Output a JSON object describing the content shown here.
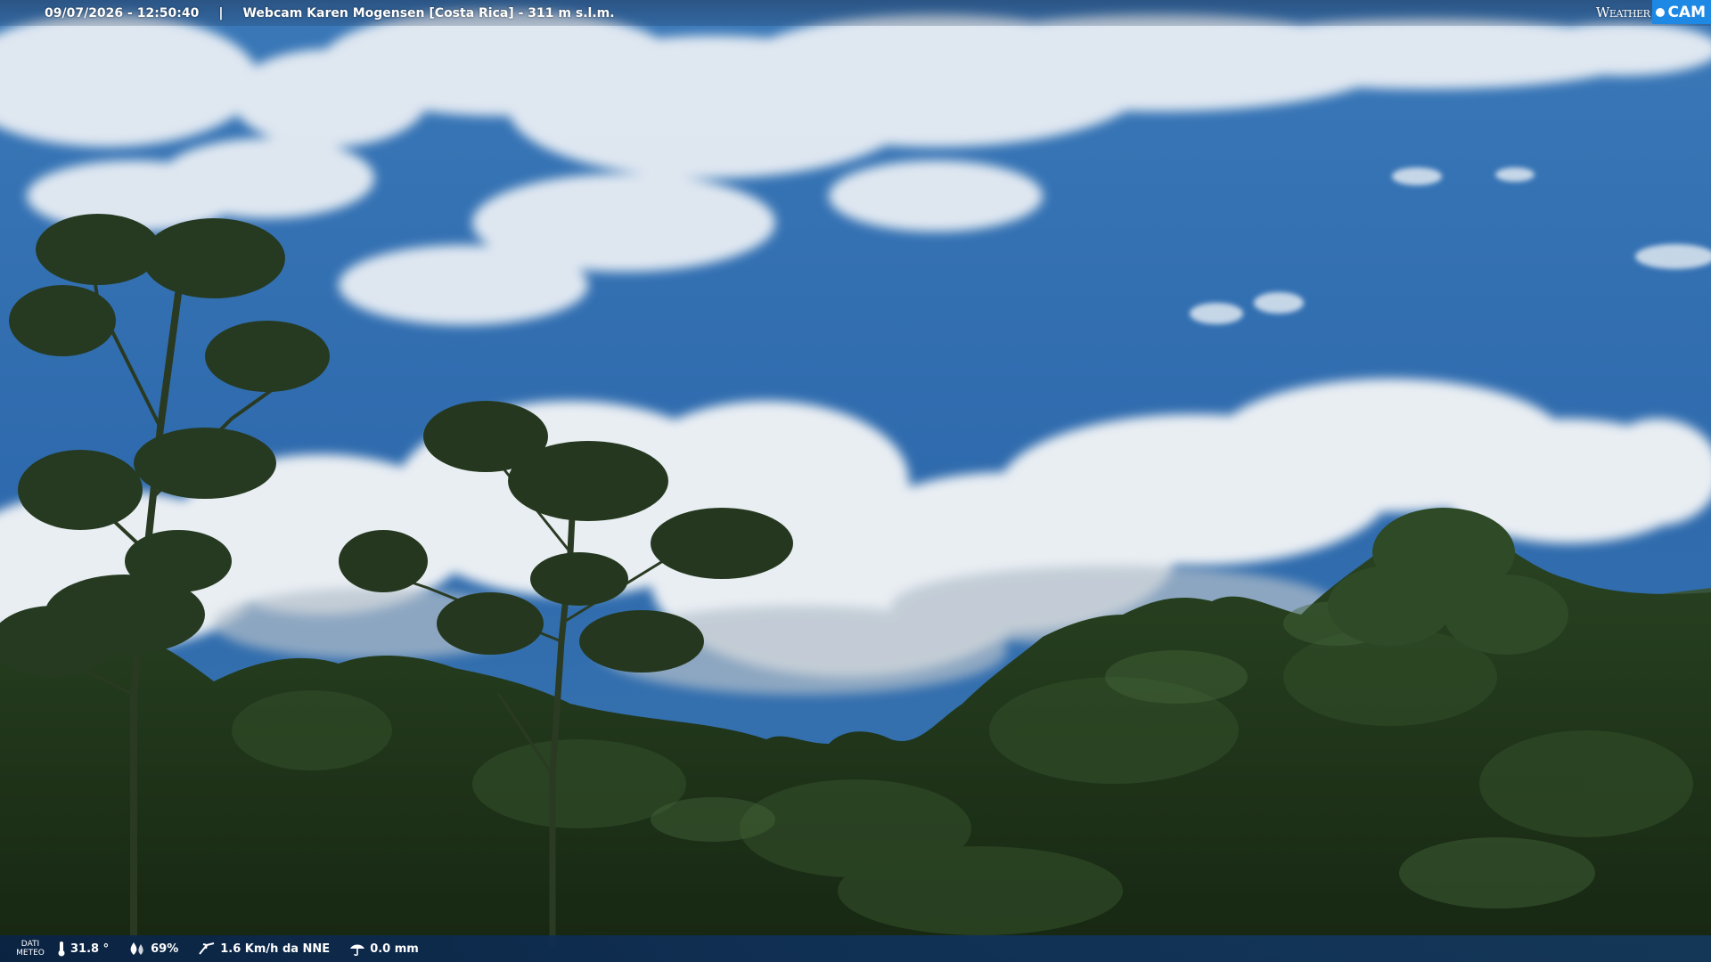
{
  "overlay": {
    "datetime": "09/07/2026 - 12:50:40",
    "separator": "|",
    "title": "Webcam Karen Mogensen [Costa Rica]  - 311 m s.l.m."
  },
  "brand": {
    "weather_text": "Weather",
    "cam_text": "CAM",
    "color": "#1e88e5"
  },
  "weather_bar": {
    "label_line1": "DATI",
    "label_line2": "METEO",
    "temperature": "31.8 °",
    "humidity": "69%",
    "wind": "1.6 Km/h da NNE",
    "rain": "0.0 mm",
    "icons": [
      "thermometer-icon",
      "humidity-icon",
      "wind-icon",
      "rain-icon"
    ]
  },
  "scene": {
    "sky_color": "#2d6aab",
    "forest_color": "#1f3418"
  }
}
